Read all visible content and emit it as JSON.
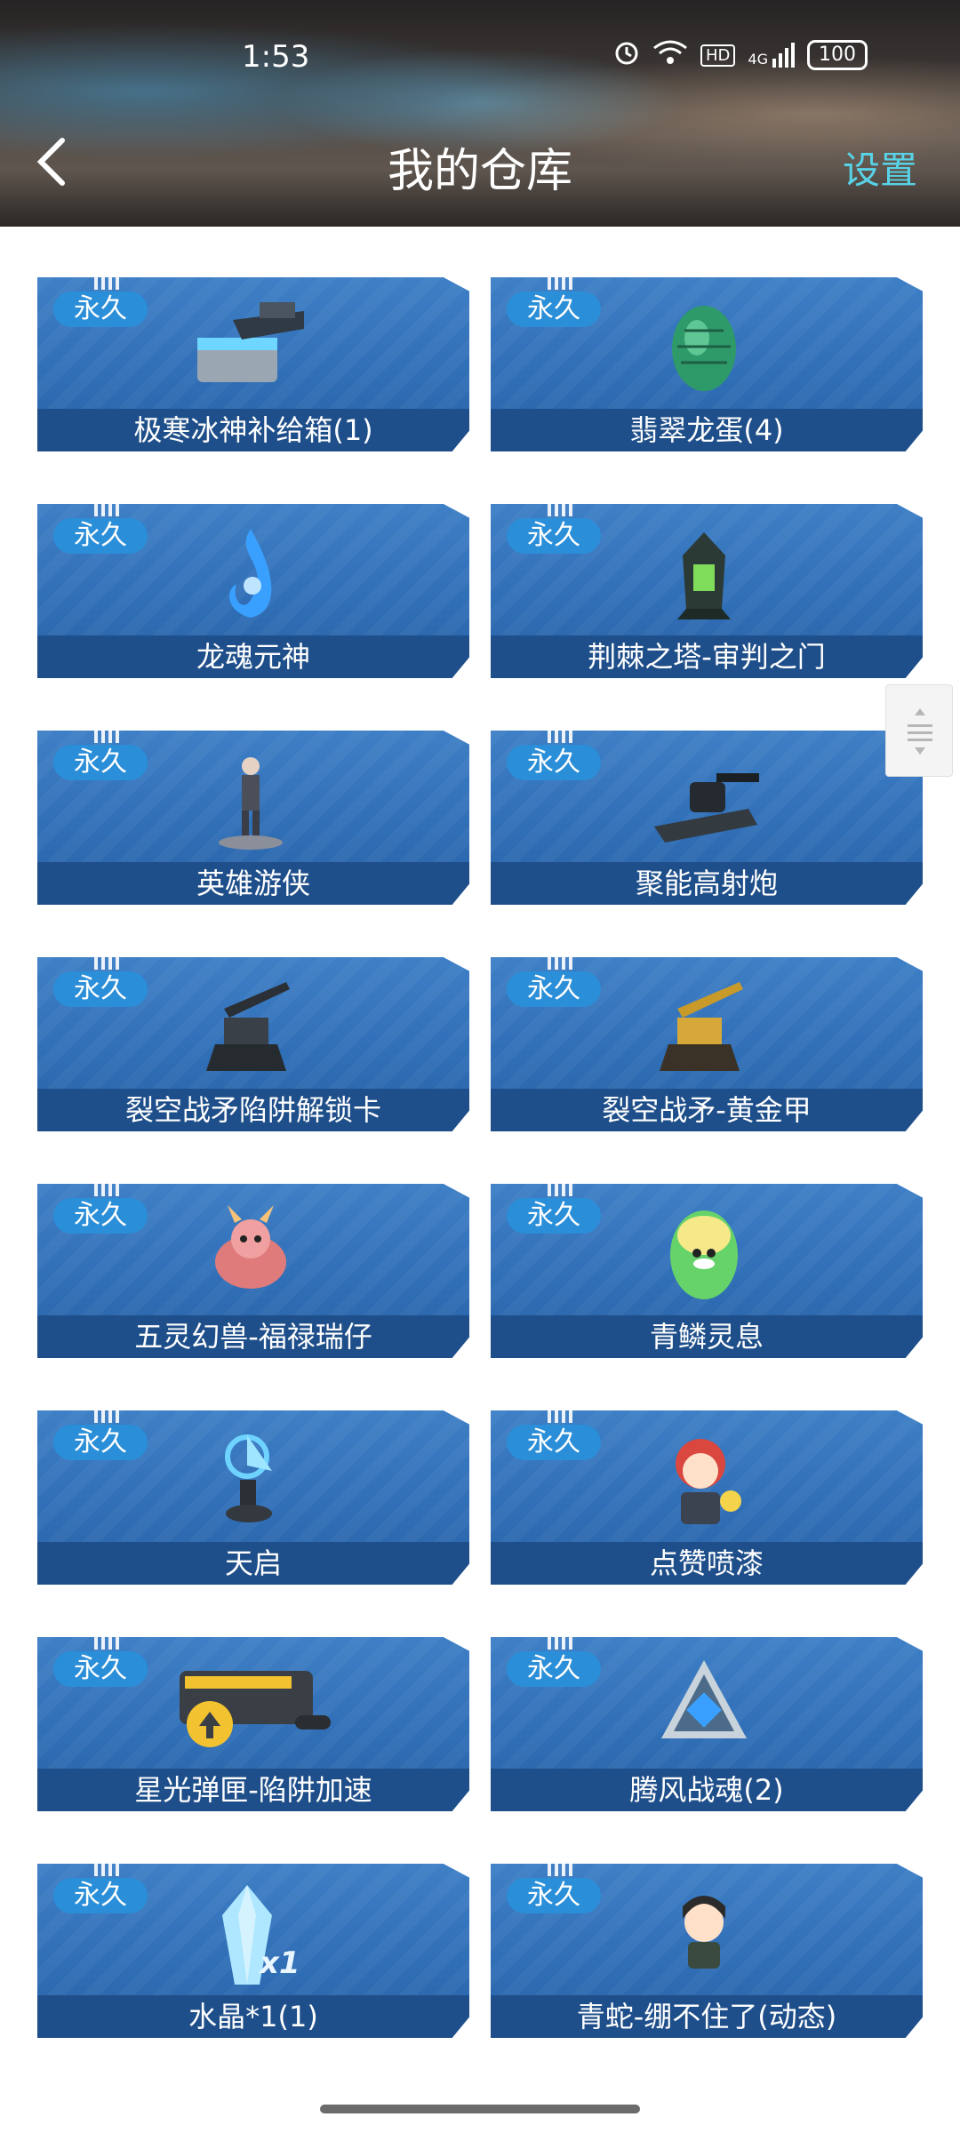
{
  "status_bar": {
    "time": "1:53",
    "battery": "100",
    "network": "4G",
    "hd": "HD"
  },
  "header": {
    "title": "我的仓库",
    "settings_label": "设置"
  },
  "items": [
    {
      "tag": "永久",
      "name": "极寒冰神补给箱(1)",
      "icon": "supply-box-icon"
    },
    {
      "tag": "永久",
      "name": "翡翠龙蛋(4)",
      "icon": "dragon-egg-icon"
    },
    {
      "tag": "永久",
      "name": "龙魂元神",
      "icon": "blue-flame-icon"
    },
    {
      "tag": "永久",
      "name": "荆棘之塔-审判之门",
      "icon": "tower-icon"
    },
    {
      "tag": "永久",
      "name": "英雄游侠",
      "icon": "hero-figure-icon"
    },
    {
      "tag": "永久",
      "name": "聚能高射炮",
      "icon": "cannon-icon"
    },
    {
      "tag": "永久",
      "name": "裂空战矛陷阱解锁卡",
      "icon": "turret-icon"
    },
    {
      "tag": "永久",
      "name": "裂空战矛-黄金甲",
      "icon": "golden-turret-icon"
    },
    {
      "tag": "永久",
      "name": "五灵幻兽-福禄瑞仔",
      "icon": "beast-pet-icon"
    },
    {
      "tag": "永久",
      "name": "青鳞灵息",
      "icon": "green-egg-icon"
    },
    {
      "tag": "永久",
      "name": "天启",
      "icon": "apocalypse-tower-icon"
    },
    {
      "tag": "永久",
      "name": "点赞喷漆",
      "icon": "like-spray-icon"
    },
    {
      "tag": "永久",
      "name": "星光弹匣-陷阱加速",
      "icon": "ammo-clip-icon"
    },
    {
      "tag": "永久",
      "name": "腾风战魂(2)",
      "icon": "war-soul-icon"
    },
    {
      "tag": "永久",
      "name": "水晶*1(1)",
      "icon": "crystal-icon"
    },
    {
      "tag": "永久",
      "name": "青蛇-绷不住了(动态)",
      "icon": "avatar-sticker-icon"
    }
  ],
  "crystal_badge": "x1"
}
